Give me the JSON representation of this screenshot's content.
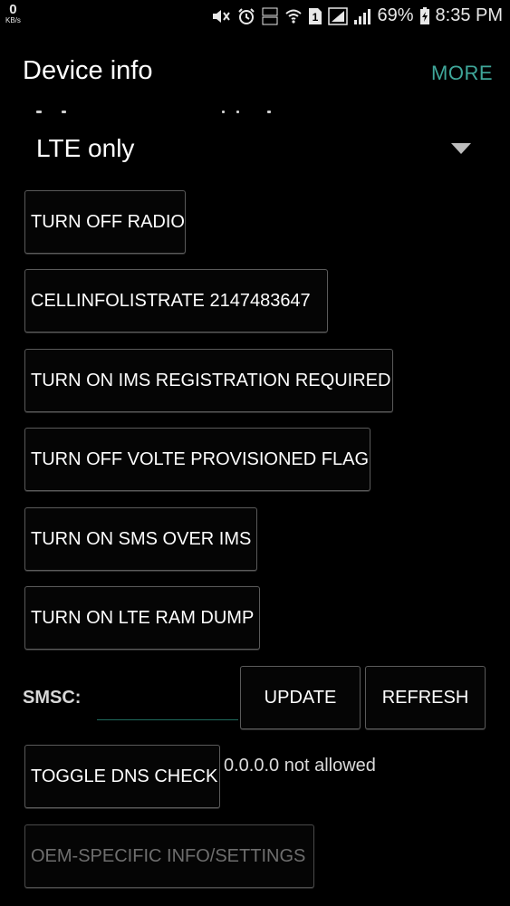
{
  "status_bar": {
    "net_speed_value": "0",
    "net_speed_unit": "KB/s",
    "sim_slot": "1",
    "battery_percent": "69%",
    "time": "8:35 PM",
    "icons": [
      "mute-icon",
      "alarm-icon",
      "volte-icon",
      "wifi-icon",
      "sim-icon",
      "signal-icon",
      "signal-icon",
      "battery-charging-icon"
    ]
  },
  "app_bar": {
    "title": "Device info",
    "more_label": "MORE"
  },
  "network_type": {
    "selected": "LTE only"
  },
  "buttons": {
    "turn_off_radio": "TURN OFF RADIO",
    "cellinfo_rate": "CELLINFOLISTRATE 2147483647",
    "ims_registration": "TURN ON IMS REGISTRATION REQUIRED",
    "volte_flag": "TURN OFF VOLTE PROVISIONED FLAG",
    "sms_over_ims": "TURN ON SMS OVER IMS",
    "lte_ram_dump": "TURN ON LTE RAM DUMP",
    "update": "UPDATE",
    "refresh": "REFRESH",
    "toggle_dns": "TOGGLE DNS CHECK",
    "oem_settings": "OEM-SPECIFIC INFO/SETTINGS"
  },
  "smsc": {
    "label": "SMSC:",
    "value": ""
  },
  "dns_status": "0.0.0.0 not allowed",
  "colors": {
    "background": "#000000",
    "accent": "#3fa79a",
    "button_border": "#5a5a5a",
    "disabled_text": "#6e6e6e"
  }
}
